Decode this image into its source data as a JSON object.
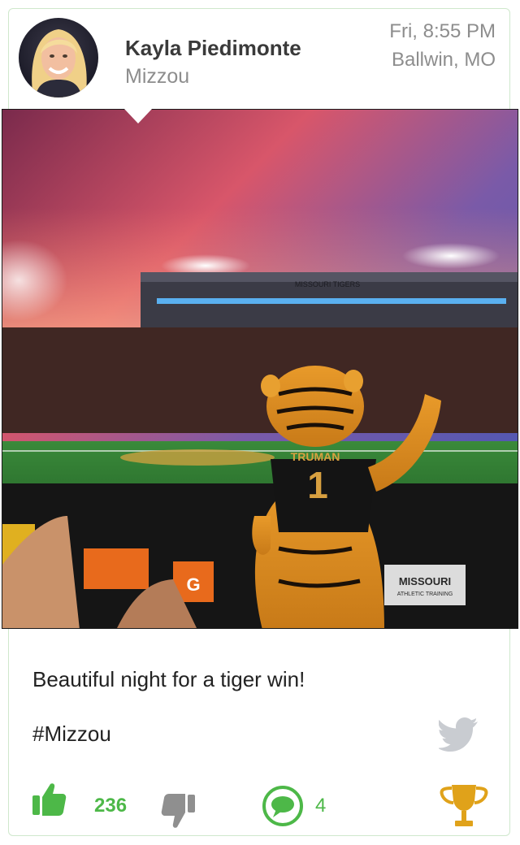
{
  "post": {
    "user_name": "Kayla Piedimonte",
    "school": "Mizzou",
    "time": "Fri, 8:55 PM",
    "location": "Ballwin, MO",
    "caption": "Beautiful night for a tiger win!",
    "hashtag": "#Mizzou"
  },
  "photo": {
    "stadium_banner": "MISSOURI TIGERS",
    "jersey_name": "TRUMAN",
    "jersey_number": "1",
    "sign_line1": "MISSOURI",
    "sign_line2": "ATHLETIC TRAINING",
    "cooler_letter": "G"
  },
  "actions": {
    "like_count": "236",
    "comment_count": "4"
  },
  "colors": {
    "accent_green": "#4db848",
    "trophy_gold": "#e0a21a",
    "twitter_gray": "#c9ccd1",
    "dislike_gray": "#8f8f8f"
  },
  "icons": [
    "thumbs-up-icon",
    "thumbs-down-icon",
    "comment-icon",
    "trophy-icon",
    "twitter-icon"
  ]
}
